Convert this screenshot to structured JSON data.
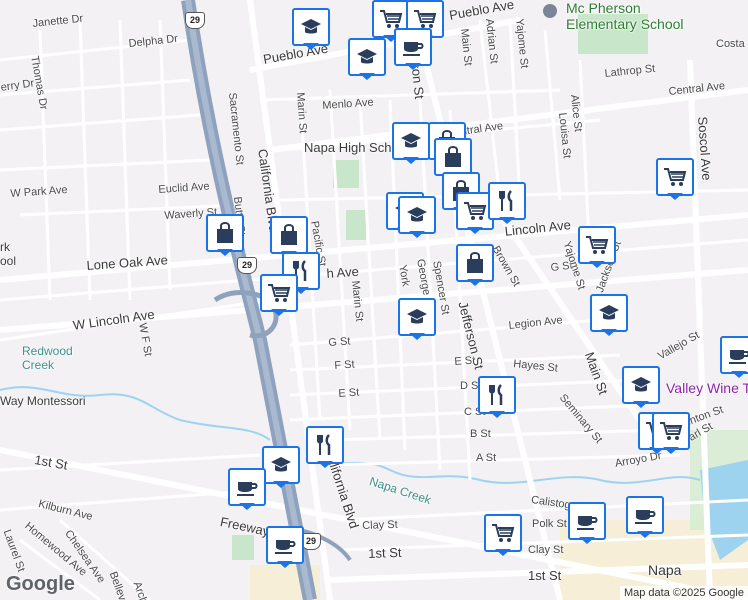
{
  "map": {
    "attribution": "Map data ©2025 Google",
    "logo": "Google",
    "colors": {
      "background": "#f3f1f4",
      "freeway": "#8fa2bd",
      "road": "#ffffff",
      "park": "#c8e6c9",
      "water": "#9ed3f0",
      "pin_border": "#1a73e8",
      "pin_icon": "#2a3d5c"
    }
  },
  "streets": [
    "Janette Dr",
    "Delpha Dr",
    "Thomas Dr",
    "erry Dr",
    "Pueblo Ave",
    "Pueblo Ave",
    "Main St",
    "Adrian St",
    "Yajome St",
    "Costa",
    "Lathrop St",
    "Central Ave",
    "Menlo Ave",
    "Marin St",
    "Sacramento St",
    "California Blvd",
    "Napa High Sch",
    "ntral Ave",
    "Alice St",
    "Louisa St",
    "W Park Ave",
    "Euclid Ave",
    "Waverly St",
    "Butte St",
    "Pacific St",
    "Soscol Ave",
    "Lincoln Ave",
    "Lone Oak Ave",
    "h Ave",
    "Marin St",
    "York",
    "George",
    "Spencer St",
    "Brown St",
    "G St",
    "Yajome St",
    "Jackson St",
    "W Lincoln Ave",
    "W F St",
    "G St",
    "F St",
    "E St",
    "Legion Ave",
    "Jefferson St",
    "Hayes St",
    "Vallejo St",
    "E St",
    "D St",
    "Main St",
    "Seminary St",
    "Clinton St",
    "C St",
    "B St",
    "A St",
    "Pearl St",
    "Arroyo Dr",
    "1st St",
    "Kilburn Ave",
    "Homewood Ave",
    "Laurel St",
    "Chelsea Ave",
    "Freeway",
    "California Blvd",
    "Calistoga",
    "Polk St",
    "Clay St",
    "Clay St",
    "1st St",
    "1st St",
    "Bellev",
    "Arch",
    "Way Montessori",
    "erson St",
    "rk",
    "ool"
  ],
  "places": {
    "school": "Mc Pherson Elementary School",
    "creek1": "Redwood Creek",
    "creek2": "Napa Creek",
    "city": "Napa",
    "winery": "Valley Wine T",
    "hwy29": "29"
  },
  "pins": [
    {
      "type": "school-icon"
    },
    {
      "type": "cart-icon"
    },
    {
      "type": "cart-icon"
    },
    {
      "type": "school-icon"
    },
    {
      "type": "coffee-icon"
    },
    {
      "type": "school-icon"
    },
    {
      "type": "school-icon"
    },
    {
      "type": "bag-icon"
    },
    {
      "type": "bag-icon"
    },
    {
      "type": "cart-icon"
    },
    {
      "type": "bag-icon"
    },
    {
      "type": "school-icon"
    },
    {
      "type": "cart-icon"
    },
    {
      "type": "restaurant-icon"
    },
    {
      "type": "bag-icon"
    },
    {
      "type": "bag-icon"
    },
    {
      "type": "restaurant-icon"
    },
    {
      "type": "bag-icon"
    },
    {
      "type": "cart-icon"
    },
    {
      "type": "cart-icon"
    },
    {
      "type": "school-icon"
    },
    {
      "type": "school-icon"
    },
    {
      "type": "restaurant-icon"
    },
    {
      "type": "school-icon"
    },
    {
      "type": "coffee-icon"
    },
    {
      "type": "cart-icon"
    },
    {
      "type": "restaurant-icon"
    },
    {
      "type": "school-icon"
    },
    {
      "type": "coffee-icon"
    },
    {
      "type": "cart-icon"
    },
    {
      "type": "coffee-icon"
    },
    {
      "type": "coffee-icon"
    },
    {
      "type": "coffee-icon"
    },
    {
      "type": "cart-icon"
    }
  ]
}
